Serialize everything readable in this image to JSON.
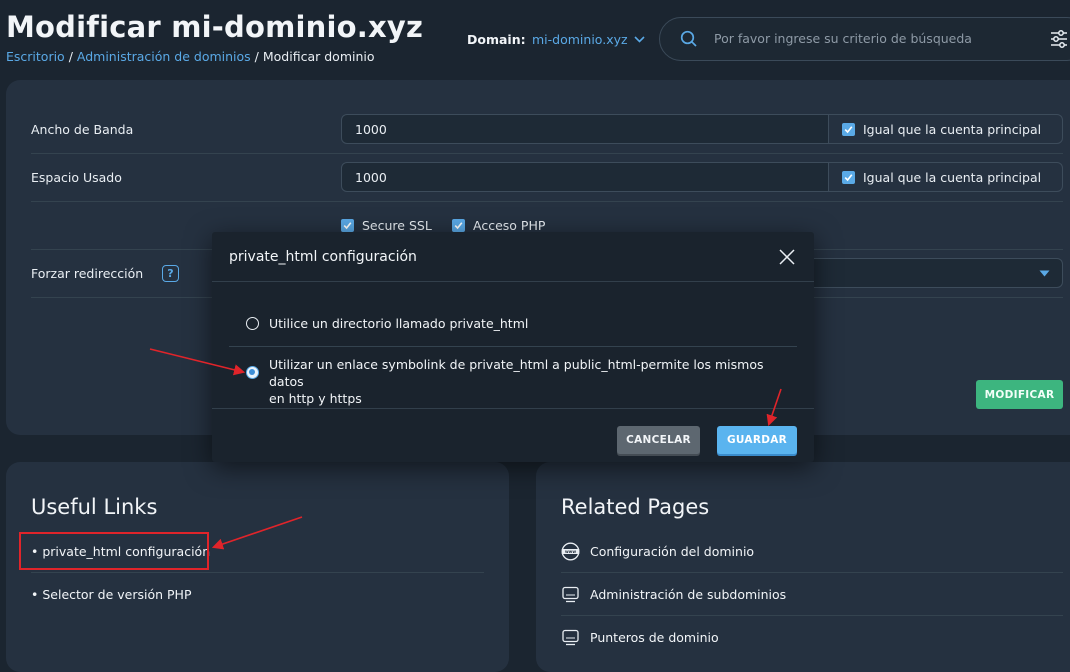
{
  "header": {
    "title": "Modificar mi-dominio.xyz",
    "breadcrumb": {
      "item1": "Escritorio",
      "sep1": " / ",
      "item2": "Administración de dominios",
      "sep2": " / ",
      "current": "Modificar dominio"
    },
    "domain_label": "Domain:",
    "domain_value": "mi-dominio.xyz",
    "search_placeholder": "Por favor ingrese su criterio de búsqueda"
  },
  "form": {
    "bandwidth_label": "Ancho de Banda",
    "bandwidth_value": "1000",
    "bandwidth_same_label": "Igual que la cuenta principal",
    "disk_label": "Espacio Usado",
    "disk_value": "1000",
    "disk_same_label": "Igual que la cuenta principal",
    "secure_ssl_label": "Secure SSL",
    "php_access_label": "Acceso PHP",
    "force_redirect_label": "Forzar redirección",
    "help_icon_text": "?",
    "submit_label": "MODIFICAR"
  },
  "modal": {
    "title": "private_html configuración",
    "option1": "Utilice un directorio llamado private_html",
    "option2_line1": "Utilizar un enlace symbolink de private_html a public_html-permite los mismos datos",
    "option2_line2": "en http y https",
    "selected_option": 2,
    "cancel_label": "CANCELAR",
    "save_label": "GUARDAR"
  },
  "useful_links": {
    "title": "Useful Links",
    "items": [
      "• private_html configuración",
      "• Selector de versión PHP"
    ]
  },
  "related_pages": {
    "title": "Related Pages",
    "items": [
      {
        "label": "Configuración del dominio",
        "icon": "www-globe-icon"
      },
      {
        "label": "Administración de subdominios",
        "icon": "monitor-icon"
      },
      {
        "label": "Punteros de dominio",
        "icon": "monitor-icon"
      }
    ]
  },
  "colors": {
    "background": "#1b2530",
    "panel": "#253140",
    "accent_blue": "#5aa9e6",
    "success_green": "#3db57f",
    "annotation_red": "#e0242a"
  }
}
